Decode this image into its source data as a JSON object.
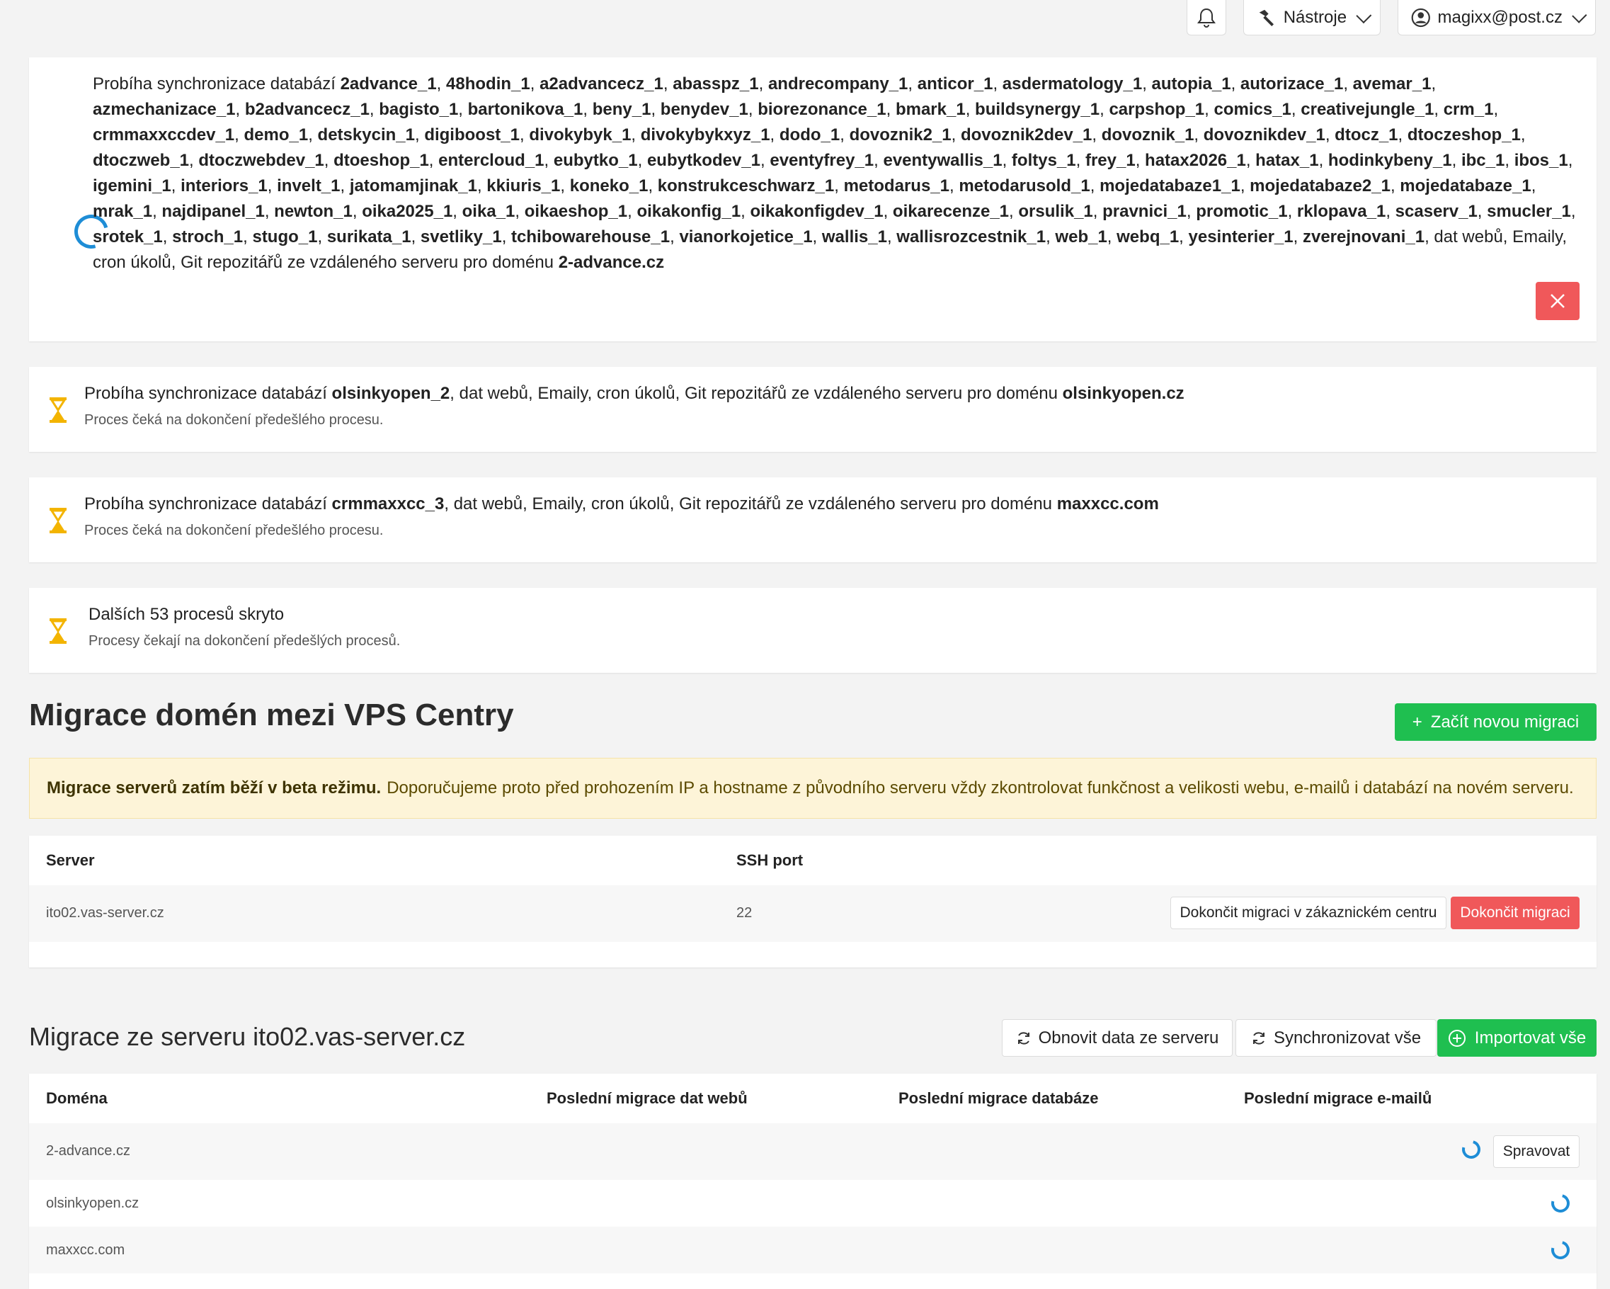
{
  "topbar": {
    "tools_label": "Nástroje",
    "user_email": "magixx@post.cz"
  },
  "sync_main": {
    "prefix": "Probíha synchronizace databází",
    "databases": [
      "2advance_1",
      "48hodin_1",
      "a2advancecz_1",
      "abasspz_1",
      "andrecompany_1",
      "anticor_1",
      "asdermatology_1",
      "autopia_1",
      "autorizace_1",
      "avemar_1",
      "azmechanizace_1",
      "b2advancecz_1",
      "bagisto_1",
      "bartonikova_1",
      "beny_1",
      "benydev_1",
      "biorezonance_1",
      "bmark_1",
      "buildsynergy_1",
      "carpshop_1",
      "comics_1",
      "creativejungle_1",
      "crm_1",
      "crmmaxxccdev_1",
      "demo_1",
      "detskycin_1",
      "digiboost_1",
      "divokybyk_1",
      "divokybykxyz_1",
      "dodo_1",
      "dovoznik2_1",
      "dovoznik2dev_1",
      "dovoznik_1",
      "dovoznikdev_1",
      "dtocz_1",
      "dtoczeshop_1",
      "dtoczweb_1",
      "dtoczwebdev_1",
      "dtoeshop_1",
      "entercloud_1",
      "eubytko_1",
      "eubytkodev_1",
      "eventyfrey_1",
      "eventywallis_1",
      "foltys_1",
      "frey_1",
      "hatax2026_1",
      "hatax_1",
      "hodinkybeny_1",
      "ibc_1",
      "ibos_1",
      "igemini_1",
      "interiors_1",
      "invelt_1",
      "jatomamjinak_1",
      "kkiuris_1",
      "koneko_1",
      "konstrukceschwarz_1",
      "metodarus_1",
      "metodarusold_1",
      "mojedatabaze1_1",
      "mojedatabaze2_1",
      "mojedatabaze_1",
      "mrak_1",
      "najdipanel_1",
      "newton_1",
      "oika2025_1",
      "oika_1",
      "oikaeshop_1",
      "oikakonfig_1",
      "oikakonfigdev_1",
      "oikarecenze_1",
      "orsulik_1",
      "pravnici_1",
      "promotic_1",
      "rklopava_1",
      "scaserv_1",
      "smucler_1",
      "srotek_1",
      "stroch_1",
      "stugo_1",
      "surikata_1",
      "svetliky_1",
      "tchibowarehouse_1",
      "vianorkojetice_1",
      "wallis_1",
      "wallisrozcestnik_1",
      "web_1",
      "webq_1",
      "yesinterier_1",
      "zverejnovani_1"
    ],
    "suffix": ", dat webů, Emaily, cron úkolů, Git repozitářů ze vzdáleného serveru pro doménu ",
    "domain": "2-advance.cz"
  },
  "pending": [
    {
      "prefix": "Probíha synchronizace databází ",
      "db": "olsinkyopen_2",
      "middle": ", dat webů, Emaily, cron úkolů, Git repozitářů ze vzdáleného serveru pro doménu ",
      "domain": "olsinkyopen.cz",
      "sub": "Proces čeká na dokončení předešlého procesu."
    },
    {
      "prefix": "Probíha synchronizace databází ",
      "db": "crmmaxxcc_3",
      "middle": ", dat webů, Emaily, cron úkolů, Git repozitářů ze vzdáleného serveru pro doménu ",
      "domain": "maxxcc.com",
      "sub": "Proces čeká na dokončení předešlého procesu."
    }
  ],
  "hidden": {
    "title": "Dalších 53 procesů skryto",
    "sub": "Procesy čekají na dokončení předešlých procesů."
  },
  "migration": {
    "title": "Migrace domén mezi VPS Centry",
    "new_button": "Začít novou migraci",
    "new_button_icon": "+",
    "alert_bold": "Migrace serverů zatím běží v beta režimu.",
    "alert_text": "Doporučujeme proto před prohozením IP a hostname z původního serveru vždy zkontrolovat funkčnost a velikosti webu, e-mailů i databází na novém serveru.",
    "table_headers": {
      "server": "Server",
      "ssh": "SSH port"
    },
    "row": {
      "server": "ito02.vas-server.cz",
      "port": "22"
    },
    "finish_center": "Dokončit migraci v zákaznickém centru",
    "finish": "Dokončit migraci"
  },
  "server_section": {
    "title": "Migrace ze serveru ito02.vas-server.cz",
    "refresh": "Obnovit data ze serveru",
    "sync_all": "Synchronizovat vše",
    "import_all": "Importovat vše",
    "headers": [
      "Doména",
      "Poslední migrace dat webů",
      "Poslední migrace databáze",
      "Poslední migrace e-mailů"
    ],
    "rows": [
      "2-advance.cz",
      "olsinkyopen.cz",
      "maxxcc.com"
    ],
    "manage": "Spravovat"
  },
  "colors": {
    "green": "#1fbf50",
    "red": "#f0585a",
    "spinner": "#1e8dd6",
    "hourglass": "#f3b400"
  }
}
